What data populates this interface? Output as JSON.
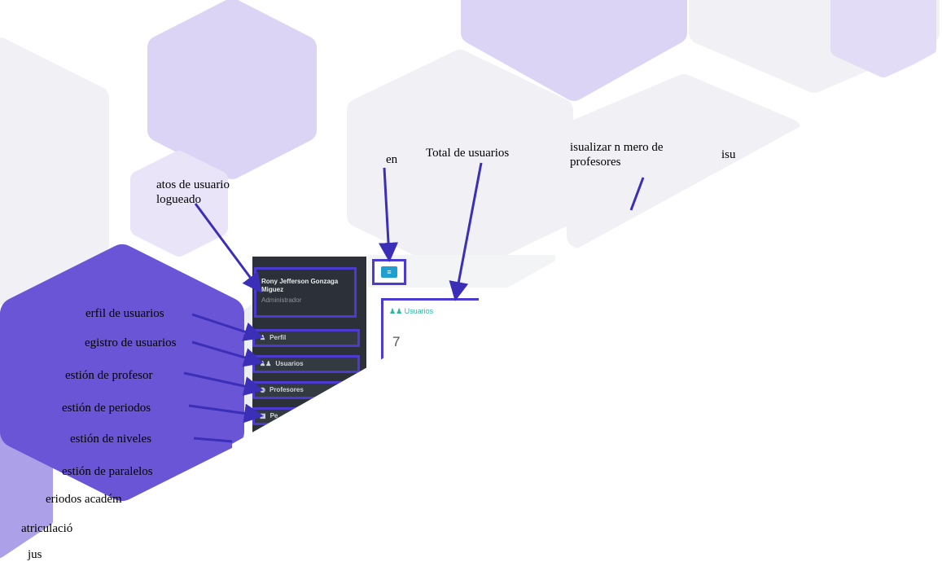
{
  "annotations": {
    "logged_user": "atos de usuario logueado",
    "menu": "en",
    "total_users": "Total de usuarios",
    "view_teachers": "isualizar n mero de profesores",
    "isu": "isu",
    "profile": "erfil de usuarios",
    "user_registry": "egistro de usuarios",
    "teacher_mgmt": "estión  de profesor",
    "period_mgmt": "estión de  periodos",
    "level_mgmt": "estión de niveles",
    "parallel_mgmt": "estión de paralelos",
    "academic_periods": "eriodos académ",
    "enrollment": "atriculació",
    "jus": "jus"
  },
  "app": {
    "user": {
      "name": "Rony Jefferson Gonzaga Miguez",
      "role": "Administrador"
    },
    "nav": [
      {
        "icon": "user-icon",
        "label": "Perfil"
      },
      {
        "icon": "users-icon",
        "label": "Usuarios"
      },
      {
        "icon": "user-circle-icon",
        "label": "Profesores"
      },
      {
        "icon": "calendar-icon",
        "label": "Pe"
      }
    ],
    "menu_button": "≡",
    "card": {
      "title": "Usuarios",
      "value": "7"
    }
  },
  "colors": {
    "accent": "#4b3bd0",
    "hex_light": "#e8e3f6",
    "hex_dark": "#6a55d6",
    "sidebar": "#2c3139"
  }
}
